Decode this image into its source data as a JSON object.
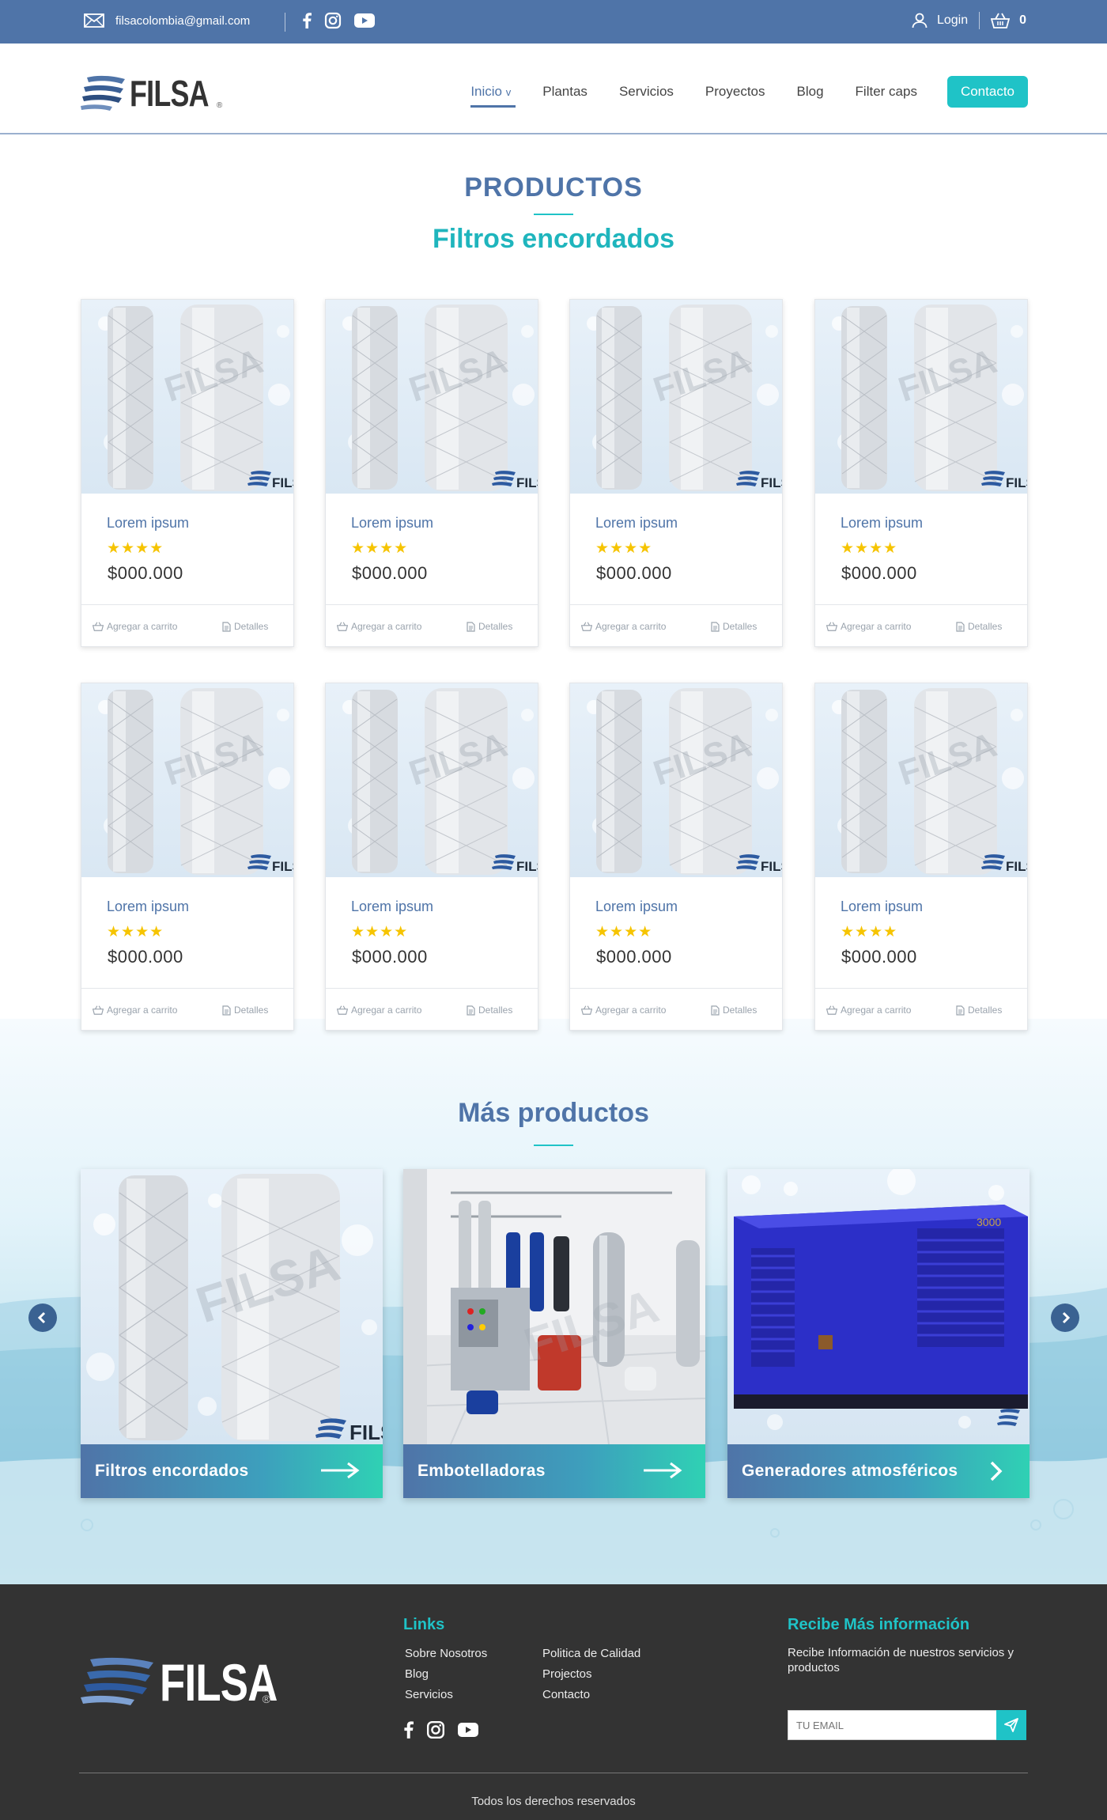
{
  "topbar": {
    "email": "filsacolombia@gmail.com",
    "login": "Login",
    "cart_count": "0"
  },
  "brand": {
    "name": "FILSA",
    "reg": "®"
  },
  "nav": {
    "items": [
      {
        "label": "Inicio",
        "caret": "v",
        "active": true
      },
      {
        "label": "Plantas"
      },
      {
        "label": "Servicios"
      },
      {
        "label": "Proyectos"
      },
      {
        "label": "Blog"
      },
      {
        "label": "Filter caps"
      }
    ],
    "contact": "Contacto"
  },
  "products_section": {
    "title": "PRODUCTOS",
    "subtitle": "Filtros encordados",
    "image_brand": "FILS",
    "cards": [
      {
        "name": "Lorem ipsum",
        "rating": 4,
        "stars": "★★★★",
        "price": "$000.000",
        "add_to_cart": "Agregar a carrito",
        "details": "Detalles"
      },
      {
        "name": "Lorem ipsum",
        "rating": 4,
        "stars": "★★★★",
        "price": "$000.000",
        "add_to_cart": "Agregar a carrito",
        "details": "Detalles"
      },
      {
        "name": "Lorem ipsum",
        "rating": 4,
        "stars": "★★★★",
        "price": "$000.000",
        "add_to_cart": "Agregar a carrito",
        "details": "Detalles"
      },
      {
        "name": "Lorem ipsum",
        "rating": 4,
        "stars": "★★★★",
        "price": "$000.000",
        "add_to_cart": "Agregar a carrito",
        "details": "Detalles"
      },
      {
        "name": "Lorem ipsum",
        "rating": 4,
        "stars": "★★★★",
        "price": "$000.000",
        "add_to_cart": "Agregar a carrito",
        "details": "Detalles"
      },
      {
        "name": "Lorem ipsum",
        "rating": 4,
        "stars": "★★★★",
        "price": "$000.000",
        "add_to_cart": "Agregar a carrito",
        "details": "Detalles"
      },
      {
        "name": "Lorem ipsum",
        "rating": 4,
        "stars": "★★★★",
        "price": "$000.000",
        "add_to_cart": "Agregar a carrito",
        "details": "Detalles"
      },
      {
        "name": "Lorem ipsum",
        "rating": 4,
        "stars": "★★★★",
        "price": "$000.000",
        "add_to_cart": "Agregar a carrito",
        "details": "Detalles"
      }
    ]
  },
  "more_products": {
    "title": "Más productos",
    "categories": [
      {
        "label": "Filtros encordados",
        "image_brand": "FILS"
      },
      {
        "label": "Embotelladoras"
      },
      {
        "label": "Generadores atmosféricos",
        "image_text": "3000"
      }
    ]
  },
  "footer": {
    "links_title": "Links",
    "links_col1": [
      "Sobre Nosotros",
      "Blog",
      "Servicios"
    ],
    "links_col2": [
      "Politica de Calidad",
      "Projectos",
      "Contacto"
    ],
    "info_title": "Recibe Más información",
    "info_text": "Recibe Información de nuestros servicios y productos",
    "email_placeholder": "TU EMAIL",
    "copyright": "Todos los derechos reservados"
  },
  "colors": {
    "primary": "#4f74a8",
    "accent": "#1fc3c7",
    "star": "#f6c400",
    "footer_bg": "#333333"
  },
  "icons": [
    "mail-icon",
    "facebook-icon",
    "instagram-icon",
    "youtube-icon",
    "user-icon",
    "basket-icon",
    "cart-icon",
    "document-icon",
    "arrow-right-icon",
    "chevron-left-icon",
    "chevron-right-icon",
    "send-icon"
  ]
}
